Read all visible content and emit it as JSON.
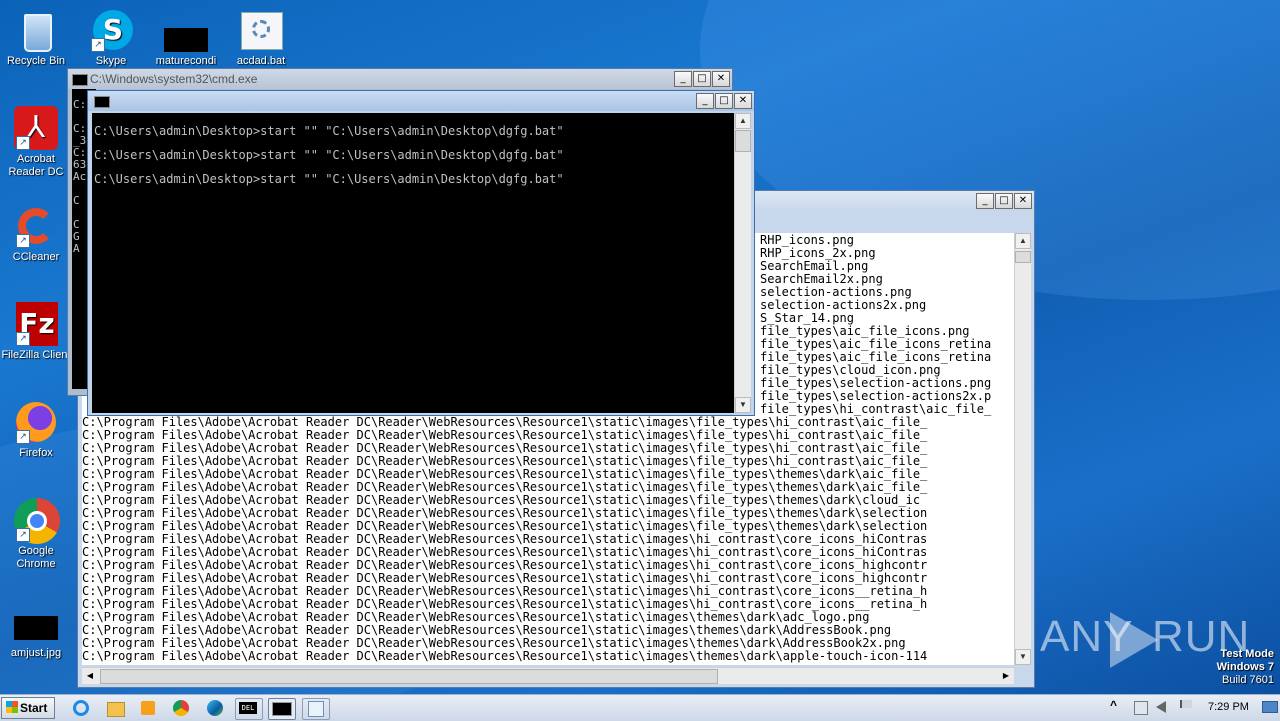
{
  "desktop": {
    "icons": [
      {
        "label": "Recycle Bin",
        "icon": "recycle-bin-icon"
      },
      {
        "label": "Skype",
        "icon": "skype-icon"
      },
      {
        "label": "maturecondi",
        "icon": "black-thumbnail-icon"
      },
      {
        "label": "acdad.bat",
        "icon": "batch-file-icon"
      },
      {
        "label": "Acrobat Reader DC",
        "icon": "acrobat-icon"
      },
      {
        "label": "CCleaner",
        "icon": "ccleaner-icon"
      },
      {
        "label": "FileZilla Client",
        "icon": "filezilla-icon"
      },
      {
        "label": "Firefox",
        "icon": "firefox-icon"
      },
      {
        "label": "Google Chrome",
        "icon": "chrome-icon"
      },
      {
        "label": "amjust.jpg",
        "icon": "black-thumbnail-icon"
      }
    ]
  },
  "cmd_back": {
    "title": "C:\\Windows\\system32\\cmd.exe",
    "peek_lines": [
      "C:",
      "",
      "C:",
      "_3",
      "C:",
      "63",
      "Ac",
      "",
      "C",
      "",
      "C",
      "G",
      "A"
    ]
  },
  "cmd_front": {
    "title": "",
    "lines": [
      "C:\\Users\\admin\\Desktop>start \"\" \"C:\\Users\\admin\\Desktop\\dgfg.bat\"",
      "C:\\Users\\admin\\Desktop>start \"\" \"C:\\Users\\admin\\Desktop\\dgfg.bat\"",
      "C:\\Users\\admin\\Desktop>start \"\" \"C:\\Users\\admin\\Desktop\\dgfg.bat\""
    ]
  },
  "file_window": {
    "prefix": "C:\\Program Files\\Adobe\\Acrobat Reader DC\\Reader\\WebResources\\Resource1\\static\\images\\",
    "right_lines": [
      "RHP_icons.png",
      "RHP_icons_2x.png",
      "SearchEmail.png",
      "SearchEmail2x.png",
      "selection-actions.png",
      "selection-actions2x.png",
      "S_Star_14.png",
      "file_types\\aic_file_icons.png",
      "file_types\\aic_file_icons_retina",
      "file_types\\aic_file_icons_retina",
      "file_types\\cloud_icon.png",
      "file_types\\selection-actions.png",
      "file_types\\selection-actions2x.p",
      "file_types\\hi_contrast\\aic_file_"
    ],
    "full_lines": [
      "file_types\\hi_contrast\\aic_file_",
      "file_types\\hi_contrast\\aic_file_",
      "file_types\\hi_contrast\\aic_file_",
      "file_types\\hi_contrast\\aic_file_",
      "file_types\\themes\\dark\\aic_file_",
      "file_types\\themes\\dark\\aic_file_",
      "file_types\\themes\\dark\\cloud_ic",
      "file_types\\themes\\dark\\selection",
      "file_types\\themes\\dark\\selection",
      "hi_contrast\\core_icons_hiContras",
      "hi_contrast\\core_icons_hiContras",
      "hi_contrast\\core_icons_highcontr",
      "hi_contrast\\core_icons_highcontr",
      "hi_contrast\\core_icons__retina_h",
      "hi_contrast\\core_icons__retina_h",
      "themes\\dark\\adc_logo.png",
      "themes\\dark\\AddressBook.png",
      "themes\\dark\\AddressBook2x.png",
      "themes\\dark\\apple-touch-icon-114"
    ]
  },
  "watermark": {
    "brand": "ANY",
    "brand2": "RUN",
    "test_mode": "Test Mode",
    "os": "Windows 7",
    "build": "Build 7601"
  },
  "taskbar": {
    "start_label": "Start",
    "clock": "7:29 PM",
    "tray_up": "^",
    "items": [
      "ie-icon",
      "explorer-icon",
      "media-player-icon",
      "chrome-icon",
      "edge-icon",
      "del-icon",
      "cmd-icon",
      "notepad-icon"
    ]
  }
}
